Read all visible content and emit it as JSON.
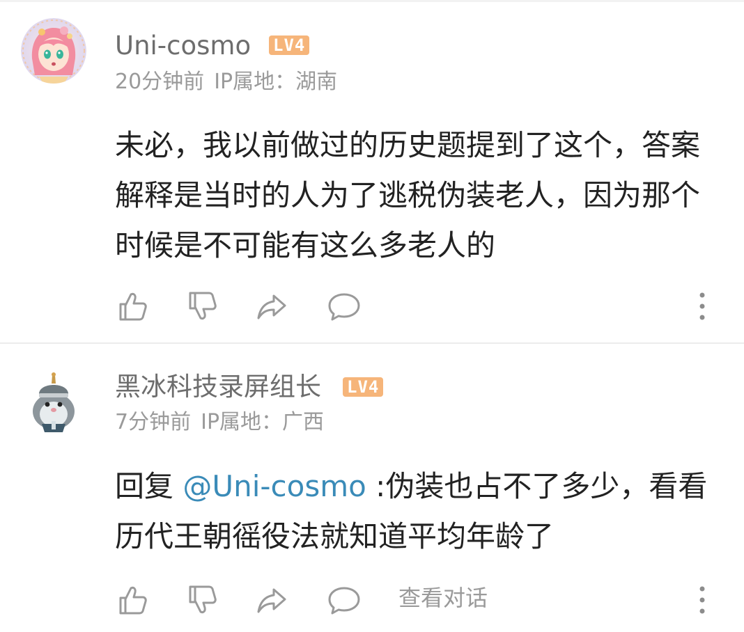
{
  "comments": [
    {
      "username": "Uni-cosmo",
      "level": "LV4",
      "time": "20分钟前",
      "ip": "IP属地：湖南",
      "text": "未必，我以前做过的历史题提到了这个，答案解释是当时的人为了逃税伪装老人，因为那个时候是不可能有这么多老人的",
      "avatar_icon": "anime-girl-avatar",
      "actions": [
        "thumbs-up-icon",
        "thumbs-down-icon",
        "share-icon",
        "comment-icon",
        "more-icon"
      ]
    },
    {
      "username": "黑冰科技录屏组长",
      "level": "LV4",
      "time": "7分钟前",
      "ip": "IP属地：广西",
      "reply_prefix": "回复 ",
      "mention": "@Uni-cosmo",
      "text": " :伪装也占不了多少，看看历代王朝徭役法就知道平均年龄了",
      "view_conversation": "查看对话",
      "avatar_icon": "hamster-soldier-avatar",
      "actions": [
        "thumbs-up-icon",
        "thumbs-down-icon",
        "share-icon",
        "comment-icon",
        "more-icon"
      ]
    }
  ],
  "colors": {
    "badge": "#f6b57a",
    "mention": "#3a8bb8",
    "text": "#222222",
    "meta": "#9a9a9a",
    "username": "#6d6d6d"
  }
}
